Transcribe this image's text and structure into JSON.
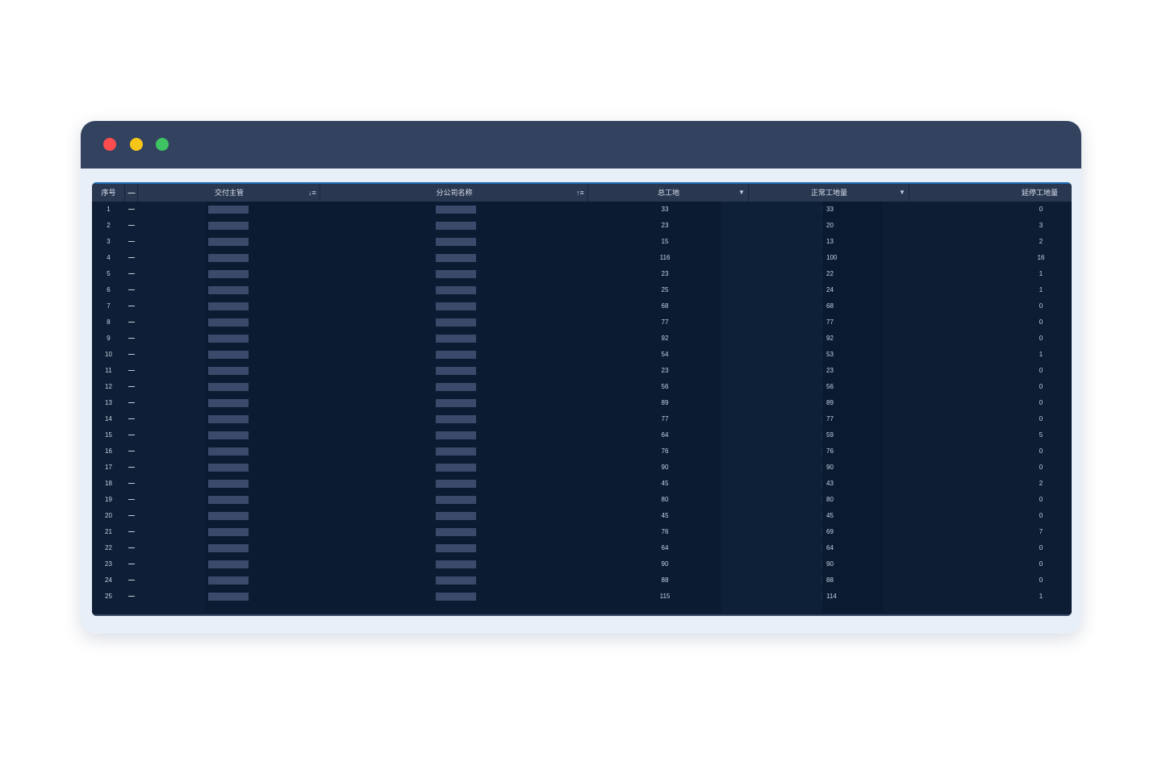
{
  "window": {
    "colors": {
      "titlebar": "#33435f",
      "close": "#ff4d4f",
      "minimize": "#f5c518",
      "maximize": "#3ec262"
    }
  },
  "table": {
    "columns": {
      "index": "序号",
      "expand": "—",
      "manager": "交付主管",
      "company": "分公司名称",
      "total": "总工地",
      "normal": "正常工地量",
      "delayed": "延停工地量"
    },
    "icons": {
      "manager_sort": "sort-desc-icon",
      "company_sort": "sort-asc-icon",
      "total_filter": "caret-down-icon",
      "normal_filter": "caret-down-icon"
    },
    "rows": [
      {
        "idx": "1",
        "dash": "—",
        "total": "33",
        "normal": "33",
        "delayed": "0"
      },
      {
        "idx": "2",
        "dash": "—",
        "total": "23",
        "normal": "20",
        "delayed": "3"
      },
      {
        "idx": "3",
        "dash": "—",
        "total": "15",
        "normal": "13",
        "delayed": "2"
      },
      {
        "idx": "4",
        "dash": "—",
        "total": "116",
        "normal": "100",
        "delayed": "16"
      },
      {
        "idx": "5",
        "dash": "—",
        "total": "23",
        "normal": "22",
        "delayed": "1"
      },
      {
        "idx": "6",
        "dash": "—",
        "total": "25",
        "normal": "24",
        "delayed": "1"
      },
      {
        "idx": "7",
        "dash": "—",
        "total": "68",
        "normal": "68",
        "delayed": "0"
      },
      {
        "idx": "8",
        "dash": "—",
        "total": "77",
        "normal": "77",
        "delayed": "0"
      },
      {
        "idx": "9",
        "dash": "—",
        "total": "92",
        "normal": "92",
        "delayed": "0"
      },
      {
        "idx": "10",
        "dash": "—",
        "total": "54",
        "normal": "53",
        "delayed": "1"
      },
      {
        "idx": "11",
        "dash": "—",
        "total": "23",
        "normal": "23",
        "delayed": "0"
      },
      {
        "idx": "12",
        "dash": "—",
        "total": "56",
        "normal": "56",
        "delayed": "0"
      },
      {
        "idx": "13",
        "dash": "—",
        "total": "89",
        "normal": "89",
        "delayed": "0"
      },
      {
        "idx": "14",
        "dash": "—",
        "total": "77",
        "normal": "77",
        "delayed": "0"
      },
      {
        "idx": "15",
        "dash": "—",
        "total": "64",
        "normal": "59",
        "delayed": "5"
      },
      {
        "idx": "16",
        "dash": "—",
        "total": "76",
        "normal": "76",
        "delayed": "0"
      },
      {
        "idx": "17",
        "dash": "—",
        "total": "90",
        "normal": "90",
        "delayed": "0"
      },
      {
        "idx": "18",
        "dash": "—",
        "total": "45",
        "normal": "43",
        "delayed": "2"
      },
      {
        "idx": "19",
        "dash": "—",
        "total": "80",
        "normal": "80",
        "delayed": "0"
      },
      {
        "idx": "20",
        "dash": "—",
        "total": "45",
        "normal": "45",
        "delayed": "0"
      },
      {
        "idx": "21",
        "dash": "—",
        "total": "76",
        "normal": "69",
        "delayed": "7"
      },
      {
        "idx": "22",
        "dash": "—",
        "total": "64",
        "normal": "64",
        "delayed": "0"
      },
      {
        "idx": "23",
        "dash": "—",
        "total": "90",
        "normal": "90",
        "delayed": "0"
      },
      {
        "idx": "24",
        "dash": "—",
        "total": "88",
        "normal": "88",
        "delayed": "0"
      },
      {
        "idx": "25",
        "dash": "—",
        "total": "115",
        "normal": "114",
        "delayed": "1"
      }
    ]
  }
}
